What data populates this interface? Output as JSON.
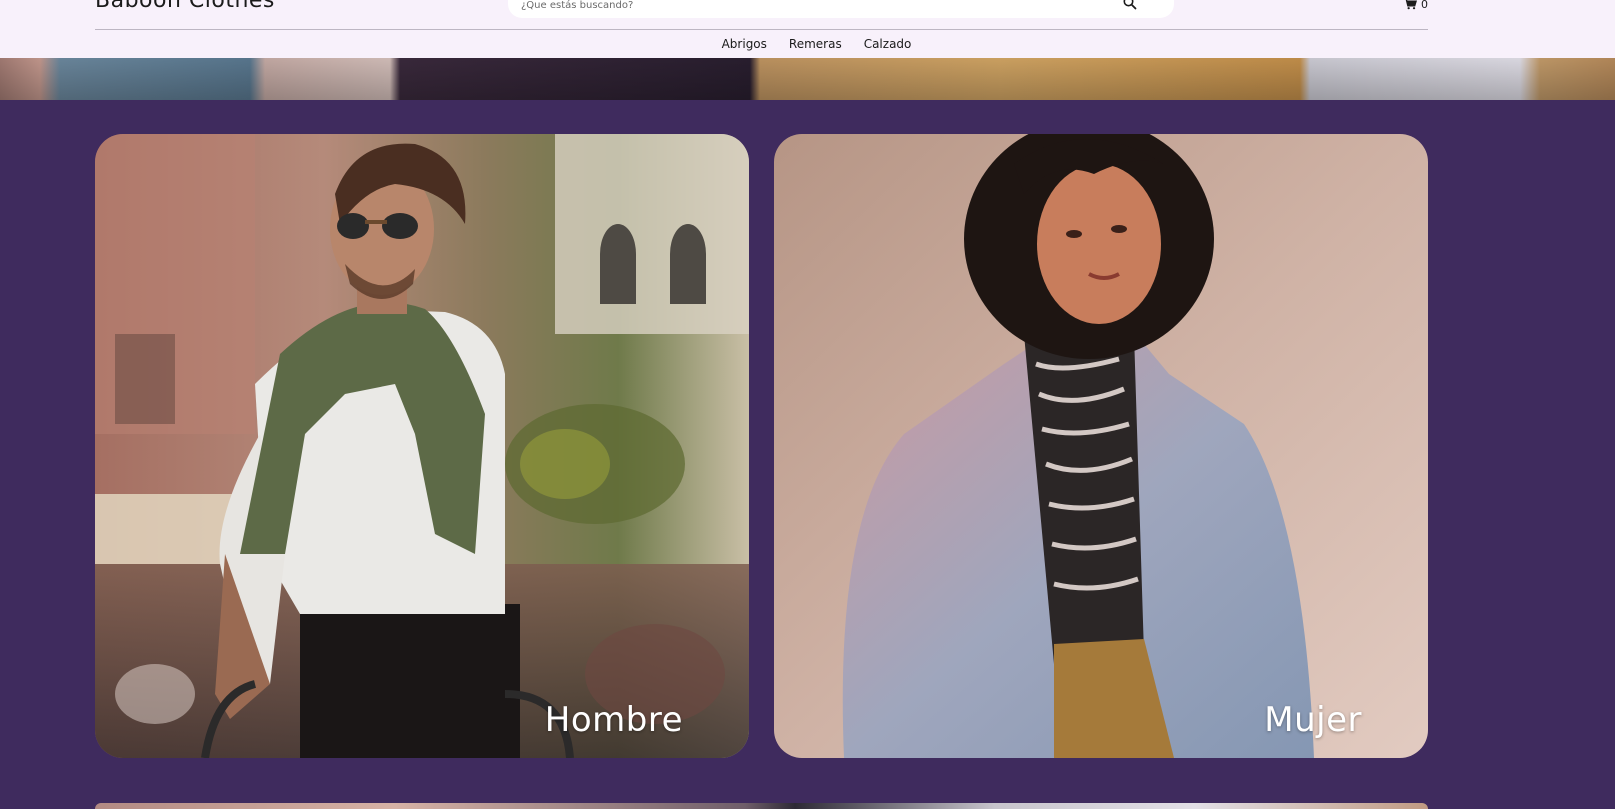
{
  "header": {
    "logo": "Baboon Clothes",
    "search_placeholder": "¿Que estás buscando?",
    "cart_count": "0"
  },
  "nav": {
    "items": [
      {
        "label": "Abrigos"
      },
      {
        "label": "Remeras"
      },
      {
        "label": "Calzado"
      }
    ]
  },
  "categories": [
    {
      "label": "Hombre"
    },
    {
      "label": "Mujer"
    }
  ],
  "colors": {
    "page_background": "#3f2b5e",
    "header_background": "#f8f1fb",
    "card_text": "#ffffff"
  }
}
